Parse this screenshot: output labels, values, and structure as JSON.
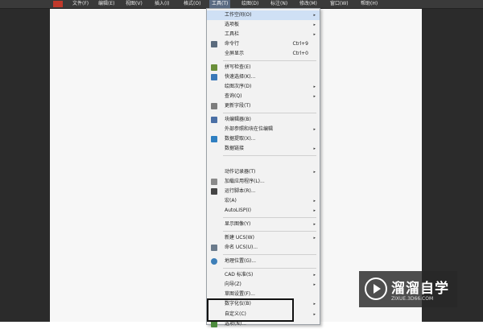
{
  "menubar": {
    "items": [
      {
        "label": "文件(F)"
      },
      {
        "label": "编辑(E)"
      },
      {
        "label": "视图(V)"
      },
      {
        "label": "插入(I)"
      },
      {
        "label": "格式(O)"
      },
      {
        "label": "工具(T)"
      },
      {
        "label": "绘图(D)"
      },
      {
        "label": "标注(N)"
      },
      {
        "label": "修改(M)"
      },
      {
        "label": "窗口(W)"
      },
      {
        "label": "帮助(H)"
      }
    ]
  },
  "tools_menu": {
    "items": [
      {
        "label": "工作空间(O)",
        "shortcut": "",
        "arrow": "▸",
        "icon": ""
      },
      {
        "label": "选项板",
        "shortcut": "",
        "arrow": "▸",
        "icon": ""
      },
      {
        "label": "工具栏",
        "shortcut": "",
        "arrow": "▸",
        "icon": ""
      },
      {
        "label": "命令行",
        "shortcut": "Ctrl+9",
        "arrow": "",
        "icon": "command-line-icon"
      },
      {
        "label": "全屏显示",
        "shortcut": "Ctrl+0",
        "arrow": "",
        "icon": ""
      },
      {
        "label": "拼写检查(E)",
        "shortcut": "",
        "arrow": "",
        "icon": "spell-check-icon"
      },
      {
        "label": "快速选择(K)...",
        "shortcut": "",
        "arrow": "",
        "icon": "quick-select-icon"
      },
      {
        "label": "绘图次序(D)",
        "shortcut": "",
        "arrow": "▸",
        "icon": ""
      },
      {
        "label": "查询(Q)",
        "shortcut": "",
        "arrow": "▸",
        "icon": ""
      },
      {
        "label": "更新字段(T)",
        "shortcut": "",
        "arrow": "",
        "icon": "update-field-icon"
      },
      {
        "label": "块编辑器(B)",
        "shortcut": "",
        "arrow": "",
        "icon": "block-editor-icon"
      },
      {
        "label": "外部参照和块在位编辑",
        "shortcut": "",
        "arrow": "▸",
        "icon": ""
      },
      {
        "label": "数据提取(X)...",
        "shortcut": "",
        "arrow": "",
        "icon": "data-extraction-icon"
      },
      {
        "label": "数据链接",
        "shortcut": "",
        "arrow": "▸",
        "icon": ""
      },
      {
        "label": "动作记录器(T)",
        "shortcut": "",
        "arrow": "▸",
        "icon": ""
      },
      {
        "label": "加载应用程序(L)...",
        "shortcut": "",
        "arrow": "",
        "icon": "load-application-icon"
      },
      {
        "label": "运行脚本(R)...",
        "shortcut": "",
        "arrow": "",
        "icon": "run-script-icon"
      },
      {
        "label": "宏(A)",
        "shortcut": "",
        "arrow": "▸",
        "icon": ""
      },
      {
        "label": "AutoLISP(I)",
        "shortcut": "",
        "arrow": "▸",
        "icon": ""
      },
      {
        "label": "显示图像(Y)",
        "shortcut": "",
        "arrow": "▸",
        "icon": ""
      },
      {
        "label": "新建 UCS(W)",
        "shortcut": "",
        "arrow": "▸",
        "icon": ""
      },
      {
        "label": "命名 UCS(U)...",
        "shortcut": "",
        "arrow": "",
        "icon": "named-ucs-icon"
      },
      {
        "label": "地理位置(G)...",
        "shortcut": "",
        "arrow": "",
        "icon": "geographic-location-icon"
      },
      {
        "label": "CAD 标准(S)",
        "shortcut": "",
        "arrow": "▸",
        "icon": ""
      },
      {
        "label": "向导(Z)",
        "shortcut": "",
        "arrow": "▸",
        "icon": ""
      },
      {
        "label": "草图设置(F)...",
        "shortcut": "",
        "arrow": "",
        "icon": ""
      },
      {
        "label": "数字化仪(B)",
        "shortcut": "",
        "arrow": "▸",
        "icon": ""
      },
      {
        "label": "自定义(C)",
        "shortcut": "",
        "arrow": "▸",
        "icon": ""
      },
      {
        "label": "选项(N)...",
        "shortcut": "",
        "arrow": "",
        "icon": "options-icon"
      }
    ]
  },
  "watermark": {
    "title": "溜溜自学",
    "url": "ZIXUE.3D66.COM"
  },
  "colors": {
    "accent_highlight": "#cfe0f5",
    "menubar_bg": "#3a3a3a",
    "menu_bg": "#f2f2f2"
  }
}
